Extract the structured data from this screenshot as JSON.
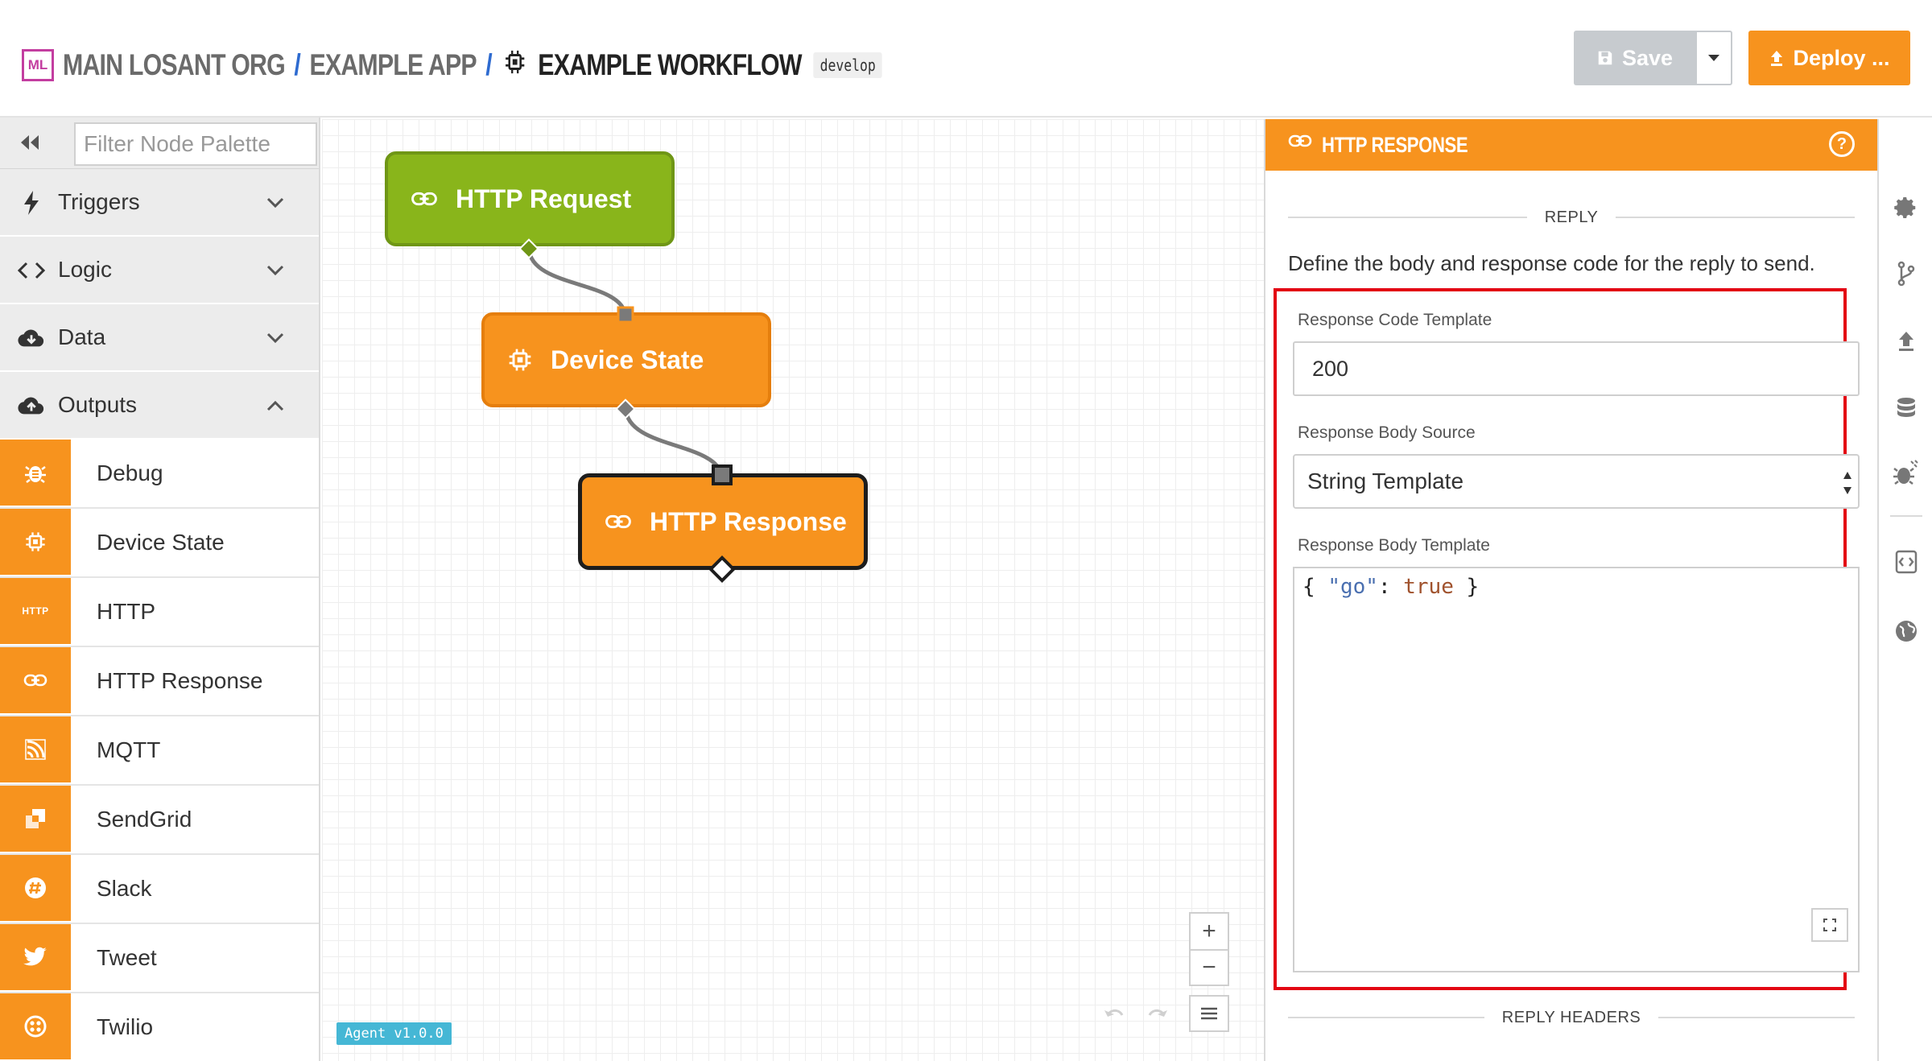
{
  "header": {
    "logo_text": "ML",
    "breadcrumbs": [
      "MAIN LOSANT ORG",
      "EXAMPLE APP"
    ],
    "separator": "/",
    "workflow_name": "EXAMPLE WORKFLOW",
    "branch": "develop",
    "save_label": "Save",
    "deploy_label": "Deploy ..."
  },
  "sidebar": {
    "filter_placeholder": "Filter Node Palette",
    "categories": [
      {
        "label": "Triggers",
        "icon": "bolt-icon",
        "expanded": false
      },
      {
        "label": "Logic",
        "icon": "code-icon",
        "expanded": false
      },
      {
        "label": "Data",
        "icon": "cloud-download-icon",
        "expanded": false
      },
      {
        "label": "Outputs",
        "icon": "cloud-upload-icon",
        "expanded": true
      }
    ],
    "output_nodes": [
      {
        "label": "Debug",
        "icon": "bug-icon"
      },
      {
        "label": "Device State",
        "icon": "chip-icon"
      },
      {
        "label": "HTTP",
        "icon": "http-icon",
        "icon_text": "HTTP"
      },
      {
        "label": "HTTP Response",
        "icon": "link-icon"
      },
      {
        "label": "MQTT",
        "icon": "rss-icon"
      },
      {
        "label": "SendGrid",
        "icon": "sendgrid-icon"
      },
      {
        "label": "Slack",
        "icon": "slack-icon"
      },
      {
        "label": "Tweet",
        "icon": "twitter-icon"
      },
      {
        "label": "Twilio",
        "icon": "twilio-icon"
      }
    ]
  },
  "canvas": {
    "nodes": [
      {
        "label": "HTTP Request",
        "icon": "link-icon",
        "color": "#89b51b"
      },
      {
        "label": "Device State",
        "icon": "chip-icon",
        "color": "#f7931e"
      },
      {
        "label": "HTTP Response",
        "icon": "link-icon",
        "color": "#f7931e",
        "selected": true
      }
    ],
    "zoom_in": "+",
    "zoom_out": "−",
    "agent_version": "Agent v1.0.0"
  },
  "panel": {
    "title": "HTTP RESPONSE",
    "help": "?",
    "section_reply": "REPLY",
    "description": "Define the body and response code for the reply to send.",
    "response_code_label": "Response Code Template",
    "response_code_value": "200",
    "body_source_label": "Response Body Source",
    "body_source_value": "String Template",
    "body_template_label": "Response Body Template",
    "body_template_value": "{ \"go\": true }",
    "code_open": "{ ",
    "code_key": "\"go\"",
    "code_colon": ": ",
    "code_val": "true",
    "code_close": " }",
    "section_reply_headers": "REPLY HEADERS"
  },
  "colors": {
    "accent": "#f7931e",
    "trigger_green": "#89b51b",
    "highlight_red": "#e30613",
    "link_blue": "#2e6bd0",
    "agent_badge": "#45b7d5"
  },
  "rail_icons": [
    "gear-icon",
    "branch-icon",
    "upload-icon",
    "database-icon",
    "bug-icon",
    "code-expand-icon",
    "globe-icon"
  ]
}
